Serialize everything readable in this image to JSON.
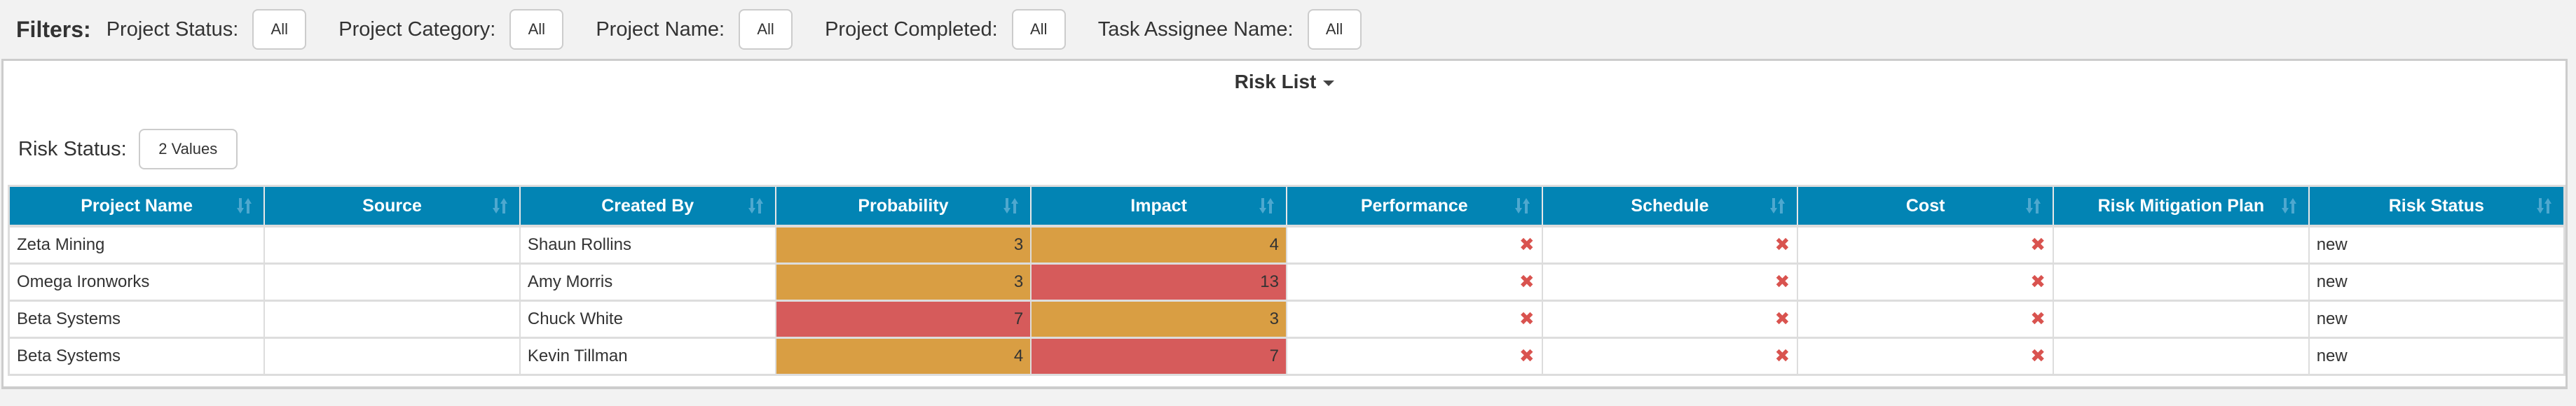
{
  "filters": {
    "title": "Filters:",
    "items": [
      {
        "label": "Project Status:",
        "value": "All"
      },
      {
        "label": "Project Category:",
        "value": "All"
      },
      {
        "label": "Project Name:",
        "value": "All"
      },
      {
        "label": "Project Completed:",
        "value": "All"
      },
      {
        "label": "Task Assignee Name:",
        "value": "All"
      }
    ]
  },
  "panel": {
    "title": "Risk List",
    "title_icon": "caret-down-icon",
    "risk_status_filter": {
      "label": "Risk Status:",
      "value": "2 Values"
    }
  },
  "colors": {
    "header_bg": "#0284b4",
    "medium": "#d99e43",
    "high": "#d65b5b",
    "x_icon": "#d9534f"
  },
  "table": {
    "columns": [
      "Project Name",
      "Source",
      "Created By",
      "Probability",
      "Impact",
      "Performance",
      "Schedule",
      "Cost",
      "Risk Mitigation Plan",
      "Risk Status"
    ],
    "sort_icon": "sort-icon",
    "rows": [
      {
        "project_name": "Zeta Mining",
        "source": "",
        "created_by": "Shaun Rollins",
        "probability": "3",
        "probability_level": "medium",
        "impact": "4",
        "impact_level": "medium",
        "performance": "x-icon",
        "schedule": "x-icon",
        "cost": "x-icon",
        "mitigation_plan": "",
        "risk_status": "new"
      },
      {
        "project_name": "Omega Ironworks",
        "source": "",
        "created_by": "Amy Morris",
        "probability": "3",
        "probability_level": "medium",
        "impact": "13",
        "impact_level": "high",
        "performance": "x-icon",
        "schedule": "x-icon",
        "cost": "x-icon",
        "mitigation_plan": "",
        "risk_status": "new"
      },
      {
        "project_name": "Beta Systems",
        "source": "",
        "created_by": "Chuck White",
        "probability": "7",
        "probability_level": "high",
        "impact": "3",
        "impact_level": "medium",
        "performance": "x-icon",
        "schedule": "x-icon",
        "cost": "x-icon",
        "mitigation_plan": "",
        "risk_status": "new"
      },
      {
        "project_name": "Beta Systems",
        "source": "",
        "created_by": "Kevin Tillman",
        "probability": "4",
        "probability_level": "medium",
        "impact": "7",
        "impact_level": "high",
        "performance": "x-icon",
        "schedule": "x-icon",
        "cost": "x-icon",
        "mitigation_plan": "",
        "risk_status": "new"
      }
    ]
  }
}
